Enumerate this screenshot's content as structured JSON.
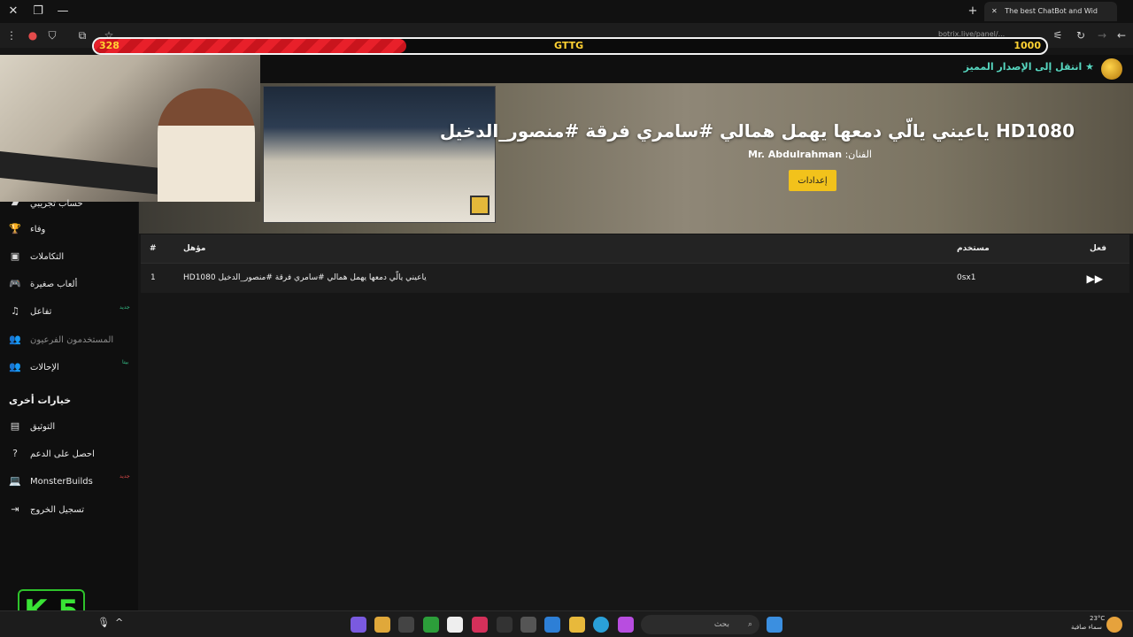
{
  "browser": {
    "tab_title": "The best ChatBot and Wid",
    "url": "botrix.live/panel/...",
    "window_buttons": [
      "close-icon",
      "restore-icon",
      "minimize-icon"
    ]
  },
  "overlay": {
    "left_value": "328",
    "middle_text": "GTTG",
    "right_value": "1000",
    "fill_fraction": 0.328,
    "colors": {
      "fill": "#e8202a",
      "text": "#ffd233",
      "border": "#f2f2f2"
    }
  },
  "appbar": {
    "premium_link": "انتقل إلى الإصدار المميز"
  },
  "hero": {
    "title": "HD1080 ياعيني يالّي دمعها يهمل همالي #سامري فرقة #منصور_الدخيل",
    "artist_label": "الفنان:",
    "artist_name": "Mr. Abdulrahman",
    "settings_button": "إعدادات",
    "accent": "#f2c21b"
  },
  "sidebar": {
    "items": [
      {
        "label": "حساب تجريبي",
        "icon": "tag-icon"
      },
      {
        "label": "وفاء",
        "icon": "trophy-icon"
      },
      {
        "label": "التكاملات",
        "icon": "integrations-icon"
      },
      {
        "label": "ألعاب صغيرة",
        "icon": "gamepad-icon"
      },
      {
        "label": "تفاعل",
        "icon": "music-icon",
        "badge": "جديد"
      },
      {
        "label": "المستخدمون الفرعيون",
        "icon": "users-icon"
      },
      {
        "label": "الإحالات",
        "icon": "referrals-icon",
        "badge": "بيتا"
      }
    ],
    "section_title": "خيارات أخرى",
    "other_items": [
      {
        "label": "التوثيق",
        "icon": "docs-icon"
      },
      {
        "label": "احصل على الدعم",
        "icon": "help-icon"
      },
      {
        "label": "MonsterBuilds",
        "icon": "laptop-icon",
        "badge": "جديد"
      },
      {
        "label": "تسجيل الخروج",
        "icon": "logout-icon"
      }
    ]
  },
  "table": {
    "headers": {
      "num": "#",
      "qualified": "مؤهل",
      "user": "مستخدم",
      "action": "فعل"
    },
    "rows": [
      {
        "num": "1",
        "qualified": "HD1080 ياعيني يالّي دمعها يهمل همالي #سامري فرقة #منصور_الدخيل",
        "user": "0sx1"
      }
    ]
  },
  "branding": {
    "k5": "K 5"
  },
  "taskbar": {
    "search_placeholder": "بحث",
    "weather_temp": "23°C",
    "weather_desc": "سماء صافية"
  }
}
